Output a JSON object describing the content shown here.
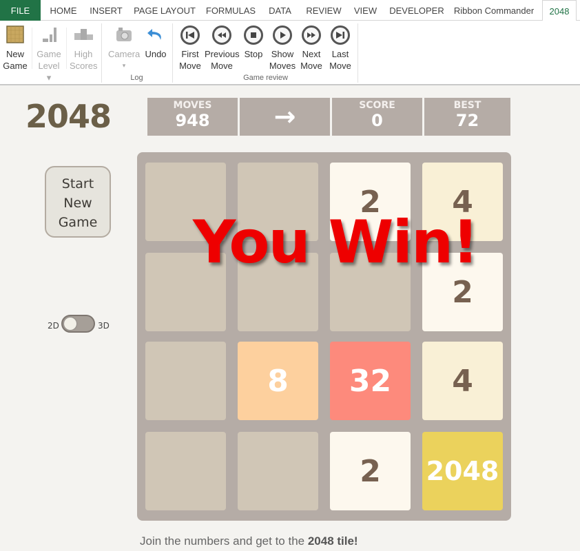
{
  "ribbon": {
    "tabs": [
      "FILE",
      "HOME",
      "INSERT",
      "PAGE LAYOUT",
      "FORMULAS",
      "DATA",
      "REVIEW",
      "VIEW",
      "DEVELOPER",
      "Ribbon Commander",
      "2048"
    ],
    "active_tab": "2048",
    "buttons": {
      "new_game": {
        "line1": "New",
        "line2": "Game",
        "icon": "board-icon"
      },
      "game_level": {
        "line1": "Game",
        "line2": "Level ▾",
        "icon": "bar-chart-icon",
        "enabled": false
      },
      "high_scores": {
        "line1": "High",
        "line2": "Scores",
        "icon": "podium-icon",
        "enabled": false
      },
      "camera": {
        "line1": "Camera",
        "line2": "▾",
        "icon": "camera-icon",
        "enabled": false
      },
      "undo": {
        "line1": "Undo",
        "line2": "",
        "icon": "undo-icon"
      },
      "first_move": {
        "line1": "First",
        "line2": "Move",
        "icon": "skip-back-icon"
      },
      "previous_move": {
        "line1": "Previous",
        "line2": "Move",
        "icon": "rewind-icon"
      },
      "stop": {
        "line1": "Stop",
        "line2": "",
        "icon": "stop-icon"
      },
      "show_moves": {
        "line1": "Show",
        "line2": "Moves",
        "icon": "play-icon"
      },
      "next_move": {
        "line1": "Next",
        "line2": "Move",
        "icon": "fast-forward-icon"
      },
      "last_move": {
        "line1": "Last",
        "line2": "Move",
        "icon": "skip-forward-icon"
      }
    },
    "groups": {
      "log": "Log",
      "game_review": "Game review"
    }
  },
  "game": {
    "title": "2048",
    "moves_label": "MOVES",
    "moves": "948",
    "direction": "→",
    "score_label": "SCORE",
    "score": "0",
    "best_label": "BEST",
    "best": "72",
    "new_game_button": [
      "Start",
      "New",
      "Game"
    ],
    "toggle_left": "2D",
    "toggle_right": "3D",
    "toggle_state": "2D",
    "overlay": "You Win!",
    "board": [
      [
        "",
        "",
        "2",
        "4"
      ],
      [
        "",
        "",
        "",
        "2"
      ],
      [
        "",
        "8",
        "32",
        "4"
      ],
      [
        "",
        "",
        "2",
        "2048"
      ]
    ],
    "footer_prefix": "Join the numbers and get to the ",
    "footer_bold": "2048 tile!"
  },
  "tile_colors": {
    "empty": {
      "bg": "#d0c6b6",
      "fg": "#776e65"
    },
    "2": {
      "bg": "#fdf8ee",
      "fg": "#776150"
    },
    "4": {
      "bg": "#f9f0d6",
      "fg": "#776150"
    },
    "8": {
      "bg": "#fdd09e",
      "fg": "#ffffff"
    },
    "32": {
      "bg": "#fd8a7c",
      "fg": "#ffffff"
    },
    "2048": {
      "bg": "#ebd25c",
      "fg": "#ffffff"
    }
  }
}
